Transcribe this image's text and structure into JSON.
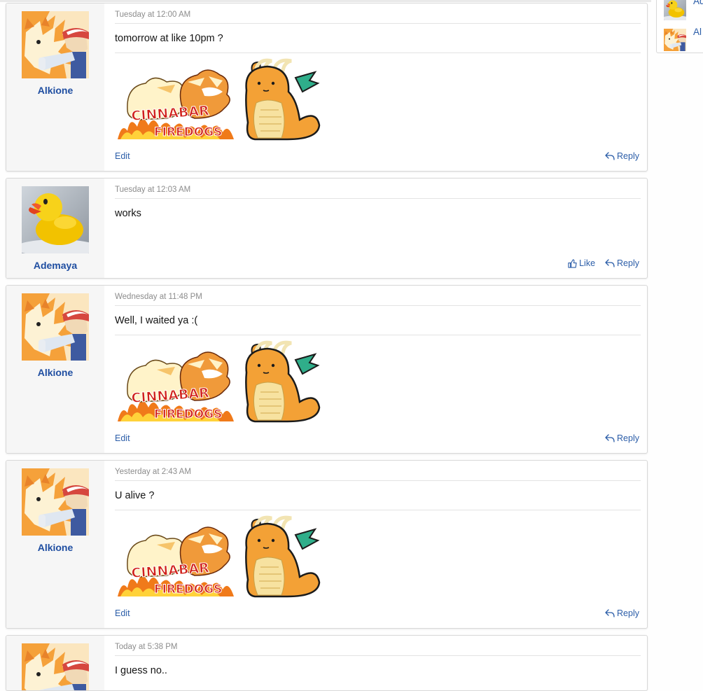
{
  "posts": [
    {
      "author": "Alkione",
      "avatar": "arcanine-trainer-avatar",
      "time": "Tuesday at 12:00 AM",
      "text": "tomorrow at like 10pm ?",
      "signature": "Cinnabar Firedogs",
      "edit_label": "Edit",
      "like_label": "",
      "reply_label": "Reply"
    },
    {
      "author": "Ademaya",
      "avatar": "rubber-duck-avatar",
      "time": "Tuesday at 12:03 AM",
      "text": "works",
      "signature": "",
      "edit_label": "",
      "like_label": "Like",
      "reply_label": "Reply"
    },
    {
      "author": "Alkione",
      "avatar": "arcanine-trainer-avatar",
      "time": "Wednesday at 11:48 PM",
      "text": "Well, I waited ya :(",
      "signature": "Cinnabar Firedogs",
      "edit_label": "Edit",
      "like_label": "",
      "reply_label": "Reply"
    },
    {
      "author": "Alkione",
      "avatar": "arcanine-trainer-avatar",
      "time": "Yesterday at 2:43 AM",
      "text": "U alive ?",
      "signature": "Cinnabar Firedogs",
      "edit_label": "Edit",
      "like_label": "",
      "reply_label": "Reply"
    },
    {
      "author": "",
      "avatar": "arcanine-trainer-avatar",
      "time": "Today at 5:38 PM",
      "text": "I guess no..",
      "signature": "",
      "edit_label": "",
      "like_label": "",
      "reply_label": ""
    }
  ],
  "sidebar": {
    "members": [
      {
        "name": "Ad",
        "avatar": "rubber-duck-avatar"
      },
      {
        "name": "Al",
        "avatar": "arcanine-trainer-avatar"
      }
    ]
  },
  "signature_banner": {
    "line1": "CINNABAR",
    "line2": "FIREDOGS"
  },
  "colors": {
    "link": "#2b5da8",
    "username": "#1f4ea1",
    "fire": "#f07a1a",
    "dragonite": "#f3a136"
  }
}
